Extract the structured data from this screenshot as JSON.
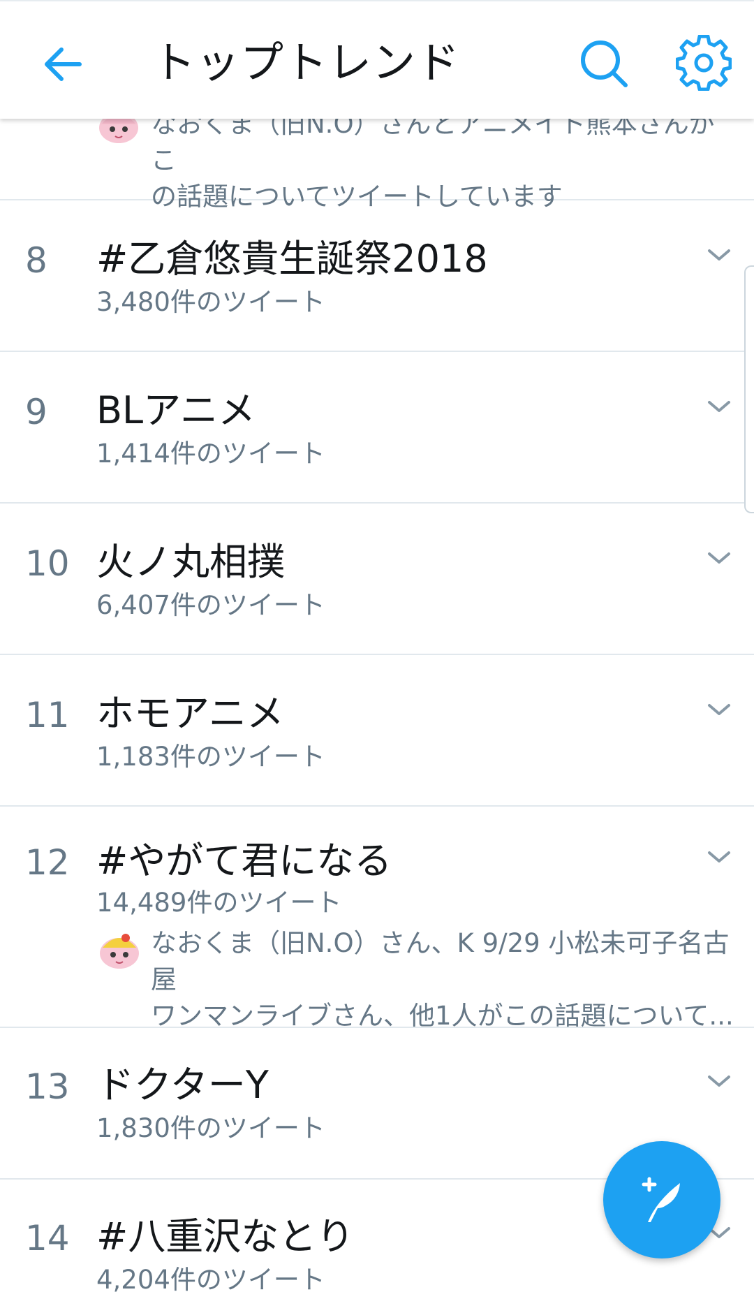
{
  "header": {
    "title": "トップトレンド",
    "icons": {
      "back": "arrow-left-icon",
      "search": "search-icon",
      "settings": "gear-icon"
    }
  },
  "partial_item": {
    "context_line1": "なおくま（旧N.O）さんとアニメイト熊本さんがこ",
    "context_line2": "の話題についてツイートしています"
  },
  "trends": [
    {
      "rank": "8",
      "name": "#乙倉悠貴生誕祭2018",
      "count": "3,480件のツイート"
    },
    {
      "rank": "9",
      "name": "BLアニメ",
      "count": "1,414件のツイート"
    },
    {
      "rank": "10",
      "name": "火ノ丸相撲",
      "count": "6,407件のツイート"
    },
    {
      "rank": "11",
      "name": "ホモアニメ",
      "count": "1,183件のツイート"
    },
    {
      "rank": "12",
      "name": "#やがて君になる",
      "count": "14,489件のツイート",
      "context_line1": "なおくま（旧N.O）さん、K 9/29 小松未可子名古屋",
      "context_line2": "ワンマンライブさん、他1人がこの話題について..."
    },
    {
      "rank": "13",
      "name": "ドクターY",
      "count": "1,830件のツイート"
    },
    {
      "rank": "14",
      "name": "#八重沢なとり",
      "count": "4,204件のツイート"
    }
  ],
  "fab": {
    "icon": "compose-tweet-icon"
  },
  "colors": {
    "accent": "#1da1f2",
    "text": "#14171a",
    "secondary": "#657786",
    "divider": "#e1e8ed"
  }
}
